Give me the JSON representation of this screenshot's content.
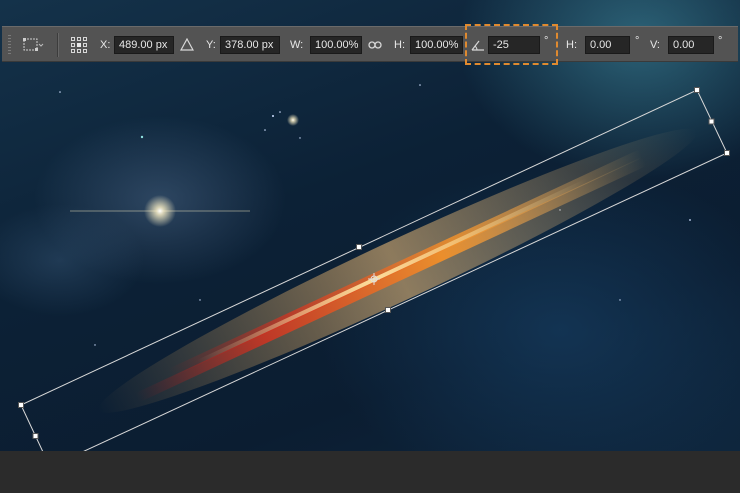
{
  "options_bar": {
    "x_label": "X:",
    "x_value": "489.00 px",
    "y_label": "Y:",
    "y_value": "378.00 px",
    "w_label": "W:",
    "w_value": "100.00%",
    "h_label": "H:",
    "h_value": "100.00%",
    "rotate_value": "-25",
    "rotate_unit": "°",
    "skew_h_label": "H:",
    "skew_h_value": "0.00",
    "skew_h_unit": "°",
    "skew_v_label": "V:",
    "skew_v_value": "0.00",
    "skew_v_unit": "°"
  },
  "icons": [
    "transform-tool-icon",
    "reference-point-icon",
    "delta-icon",
    "link-icon",
    "rotate-angle-icon"
  ],
  "colors": {
    "highlight": "#e08a2f",
    "options_bar": "#535353",
    "field_bg": "#262626"
  }
}
